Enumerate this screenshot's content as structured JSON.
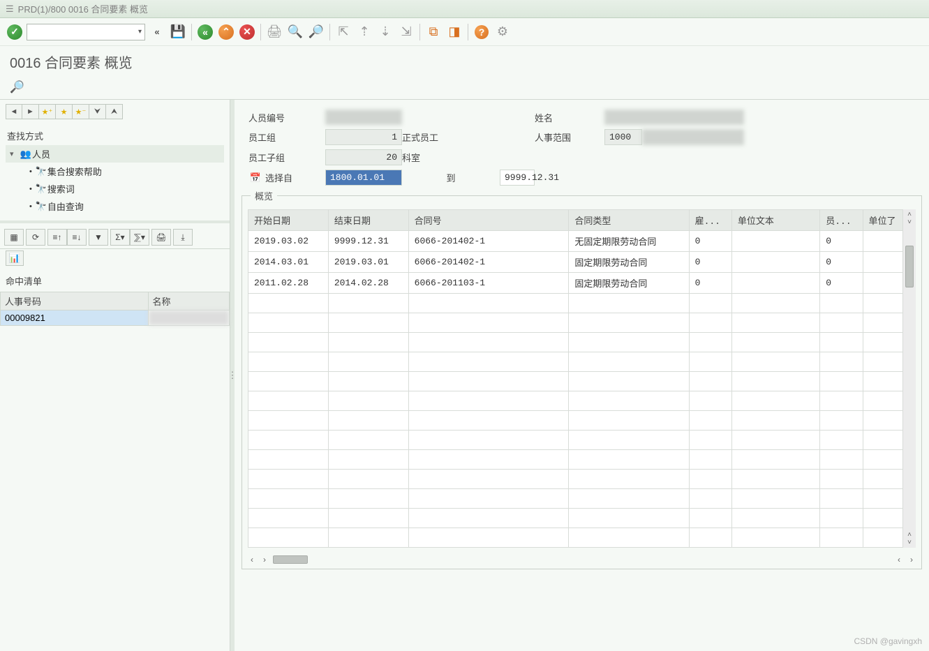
{
  "window": {
    "title": "PRD(1)/800 0016 合同要素 概览"
  },
  "subtitle": "0016 合同要素 概览",
  "tree": {
    "header": "查找方式",
    "root": "人员",
    "children": [
      "集合搜索帮助",
      "搜索词",
      "自由查询"
    ]
  },
  "hitlist": {
    "label": "命中清单",
    "cols": [
      "人事号码",
      "名称"
    ],
    "rows": [
      [
        "00009821",
        " "
      ]
    ]
  },
  "fields": {
    "personnel_no_label": "人员编号",
    "personnel_no": " ",
    "name_label": "姓名",
    "name": " ",
    "emp_group_label": "员工组",
    "emp_group_code": "1",
    "emp_group_text": "正式员工",
    "pa_label": "人事范围",
    "pa_code": "1000",
    "pa_text": " ",
    "emp_subgroup_label": "员工子组",
    "emp_subgroup_code": "20",
    "emp_subgroup_text": "科室",
    "select_from_label": "选择自",
    "select_from": "1800.01.01",
    "to_label": "到",
    "to": "9999.12.31"
  },
  "overview": {
    "title": "概览",
    "columns": [
      "开始日期",
      "结束日期",
      "合同号",
      "合同类型",
      "雇...",
      "单位文本",
      "员...",
      "单位了"
    ],
    "rows": [
      [
        "2019.03.02",
        "9999.12.31",
        "6066-201402-1",
        "无固定期限劳动合同",
        "0",
        "",
        "0",
        ""
      ],
      [
        "2014.03.01",
        "2019.03.01",
        "6066-201402-1",
        "固定期限劳动合同",
        "0",
        "",
        "0",
        ""
      ],
      [
        "2011.02.28",
        "2014.02.28",
        "6066-201103-1",
        "固定期限劳动合同",
        "0",
        "",
        "0",
        ""
      ]
    ],
    "empty_rows": 13
  },
  "watermark": "CSDN @gavingxh"
}
